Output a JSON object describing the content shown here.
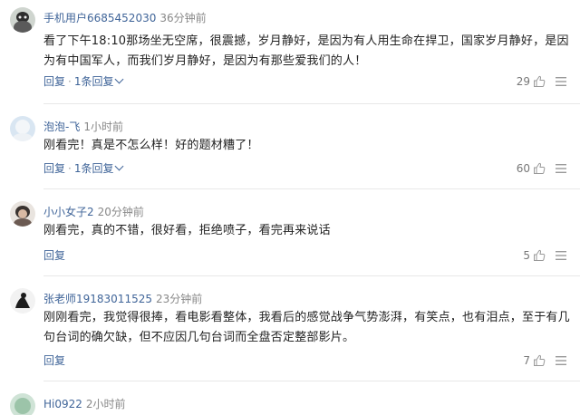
{
  "comments": [
    {
      "username": "手机用户6685452030",
      "time": "36分钟前",
      "text": "看了下午18:10那场坐无空席，很震撼，岁月静好，是因为有人用生命在捍卫，国家岁月静好，是因为有中国军人，而我们岁月静好，是因为有那些爱我们的人！",
      "reply_label": "回复",
      "replies_label": "1条回复",
      "likes": "29"
    },
    {
      "username": "泡泡-飞",
      "time": "1小时前",
      "text": "刚看完！真是不怎么样！好的题材糟了！",
      "reply_label": "回复",
      "replies_label": "1条回复",
      "likes": "60"
    },
    {
      "username": "小小女子2",
      "time": "20分钟前",
      "text": "刚看完，真的不错，很好看，拒绝喷子，看完再来说话",
      "reply_label": "回复",
      "likes": "5"
    },
    {
      "username": "张老师19183011525",
      "time": "23分钟前",
      "text": "刚刚看完，我觉得很捧，看电影看整体，我看后的感觉战争气势澎湃，有笑点，也有泪点，至于有几句台词的确欠缺，但不应因几句台词而全盘否定整部影片。",
      "reply_label": "回复",
      "likes": "7"
    },
    {
      "username": "Hi0922",
      "time": "2小时前"
    }
  ],
  "colors": {
    "username": "#406599",
    "action": "#406599",
    "meta": "#888888"
  },
  "icons": {
    "like": "thumbs-up-icon",
    "more": "more-dots-icon",
    "expand": "chevron-down-icon"
  }
}
